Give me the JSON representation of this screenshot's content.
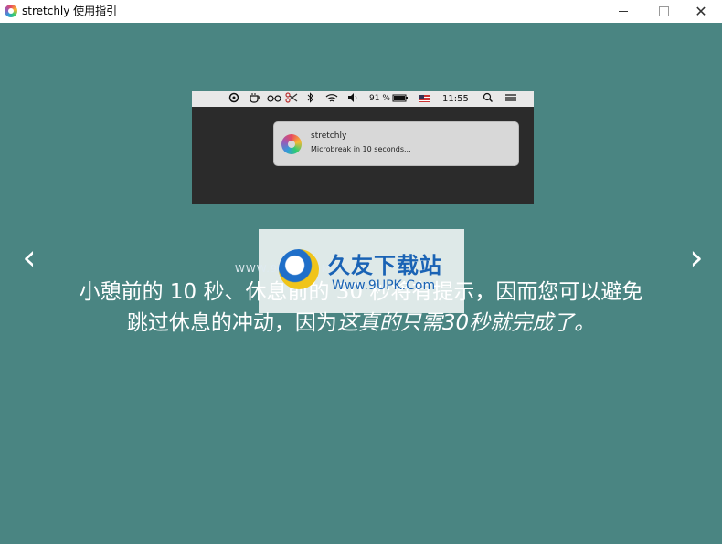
{
  "window": {
    "title": "stretchly 使用指引",
    "minimize_symbol": "—",
    "maximize_symbol": "☐",
    "close_symbol": "✕"
  },
  "screenshot": {
    "menubar": {
      "battery": "91 %",
      "time": "11:55",
      "icons": [
        "stretchly-icon",
        "coffee-icon",
        "glasses-icon",
        "scissors-icon",
        "bluetooth-icon",
        "wifi-icon",
        "volume-icon",
        "battery-icon",
        "flag-icon",
        "search-icon",
        "list-icon"
      ]
    },
    "notification": {
      "app": "stretchly",
      "message": "Microbreak in 10 seconds..."
    }
  },
  "navigation": {
    "prev": "‹",
    "next": "›"
  },
  "caption": {
    "part1": "小憩前的 10 秒、休息前的 30 秒将有提示，因而您可以避免跳过休息的冲动，因为",
    "italic": "这真的只需30秒就完成了。"
  },
  "watermark": {
    "cn": "久友下载站",
    "url": "Www.9UPK.Com",
    "url_faint": "WWW.9UPK.COM"
  }
}
